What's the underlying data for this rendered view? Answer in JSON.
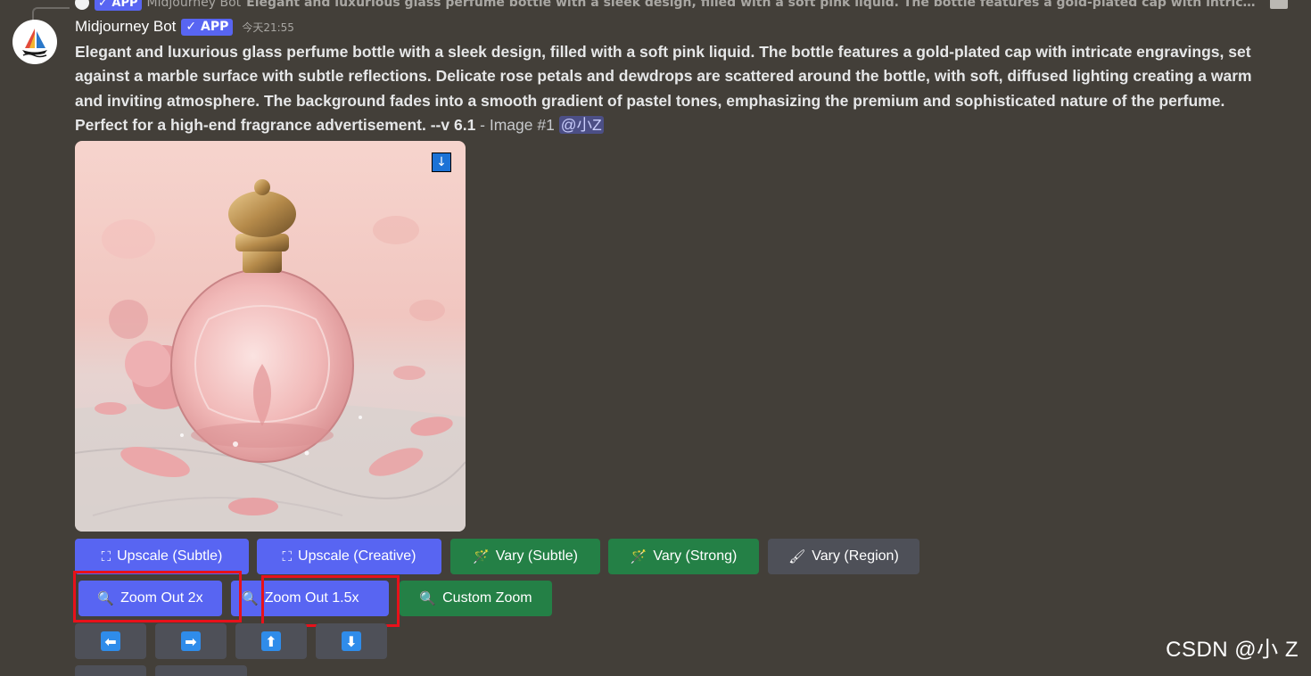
{
  "reply": {
    "badge": "✓ APP",
    "name": "Midjourney Bot",
    "text": "Elegant and luxurious glass perfume bottle with a sleek design, filled with a soft pink liquid. The bottle features a gold-plated cap with intricate..."
  },
  "message": {
    "username": "Midjourney Bot",
    "badge": "✓ APP",
    "timestamp": "今天21:55",
    "prompt": "Elegant and luxurious glass perfume bottle with a sleek design, filled with a soft pink liquid. The bottle features a gold-plated cap with intricate engravings, set against a marble surface with subtle reflections. Delicate rose petals and dewdrops are scattered around the bottle, with soft, diffused lighting creating a warm and inviting atmosphere. The background fades into a smooth gradient of pastel tones, emphasizing the premium and sophisticated nature of the perfume. Perfect for a high-end fragrance advertisement. --v 6.1",
    "suffix": " - Image #1 ",
    "mention": "@小Z"
  },
  "image": {
    "download_icon": "↓"
  },
  "buttons_row1": [
    {
      "label": "Upscale (Subtle)",
      "icon": "⛶",
      "style": "blurple"
    },
    {
      "label": "Upscale (Creative)",
      "icon": "⛶",
      "style": "blurple"
    },
    {
      "label": "Vary (Subtle)",
      "icon": "🪄",
      "style": "green"
    },
    {
      "label": "Vary (Strong)",
      "icon": "🪄",
      "style": "green"
    },
    {
      "label": "Vary (Region)",
      "icon": "🖌",
      "style": "grey"
    }
  ],
  "buttons_row2": [
    {
      "label": "Zoom Out 2x",
      "icon": "🔍",
      "style": "blurple"
    },
    {
      "label": "Zoom Out 1.5x",
      "icon": "🔍",
      "style": "blurple"
    },
    {
      "label": "Custom Zoom",
      "icon": "🔍",
      "style": "green"
    }
  ],
  "pan_buttons": [
    {
      "arrow": "⬅",
      "icon": "pan-left-icon"
    },
    {
      "arrow": "➡",
      "icon": "pan-right-icon"
    },
    {
      "arrow": "⬆",
      "icon": "pan-up-icon"
    },
    {
      "arrow": "⬇",
      "icon": "pan-down-icon"
    }
  ],
  "watermark": "CSDN @小 Z",
  "colors": {
    "background": "#433f39",
    "blurple": "#5865f2",
    "green": "#248046",
    "grey": "#4e5058",
    "highlight_red": "#e8111a"
  }
}
